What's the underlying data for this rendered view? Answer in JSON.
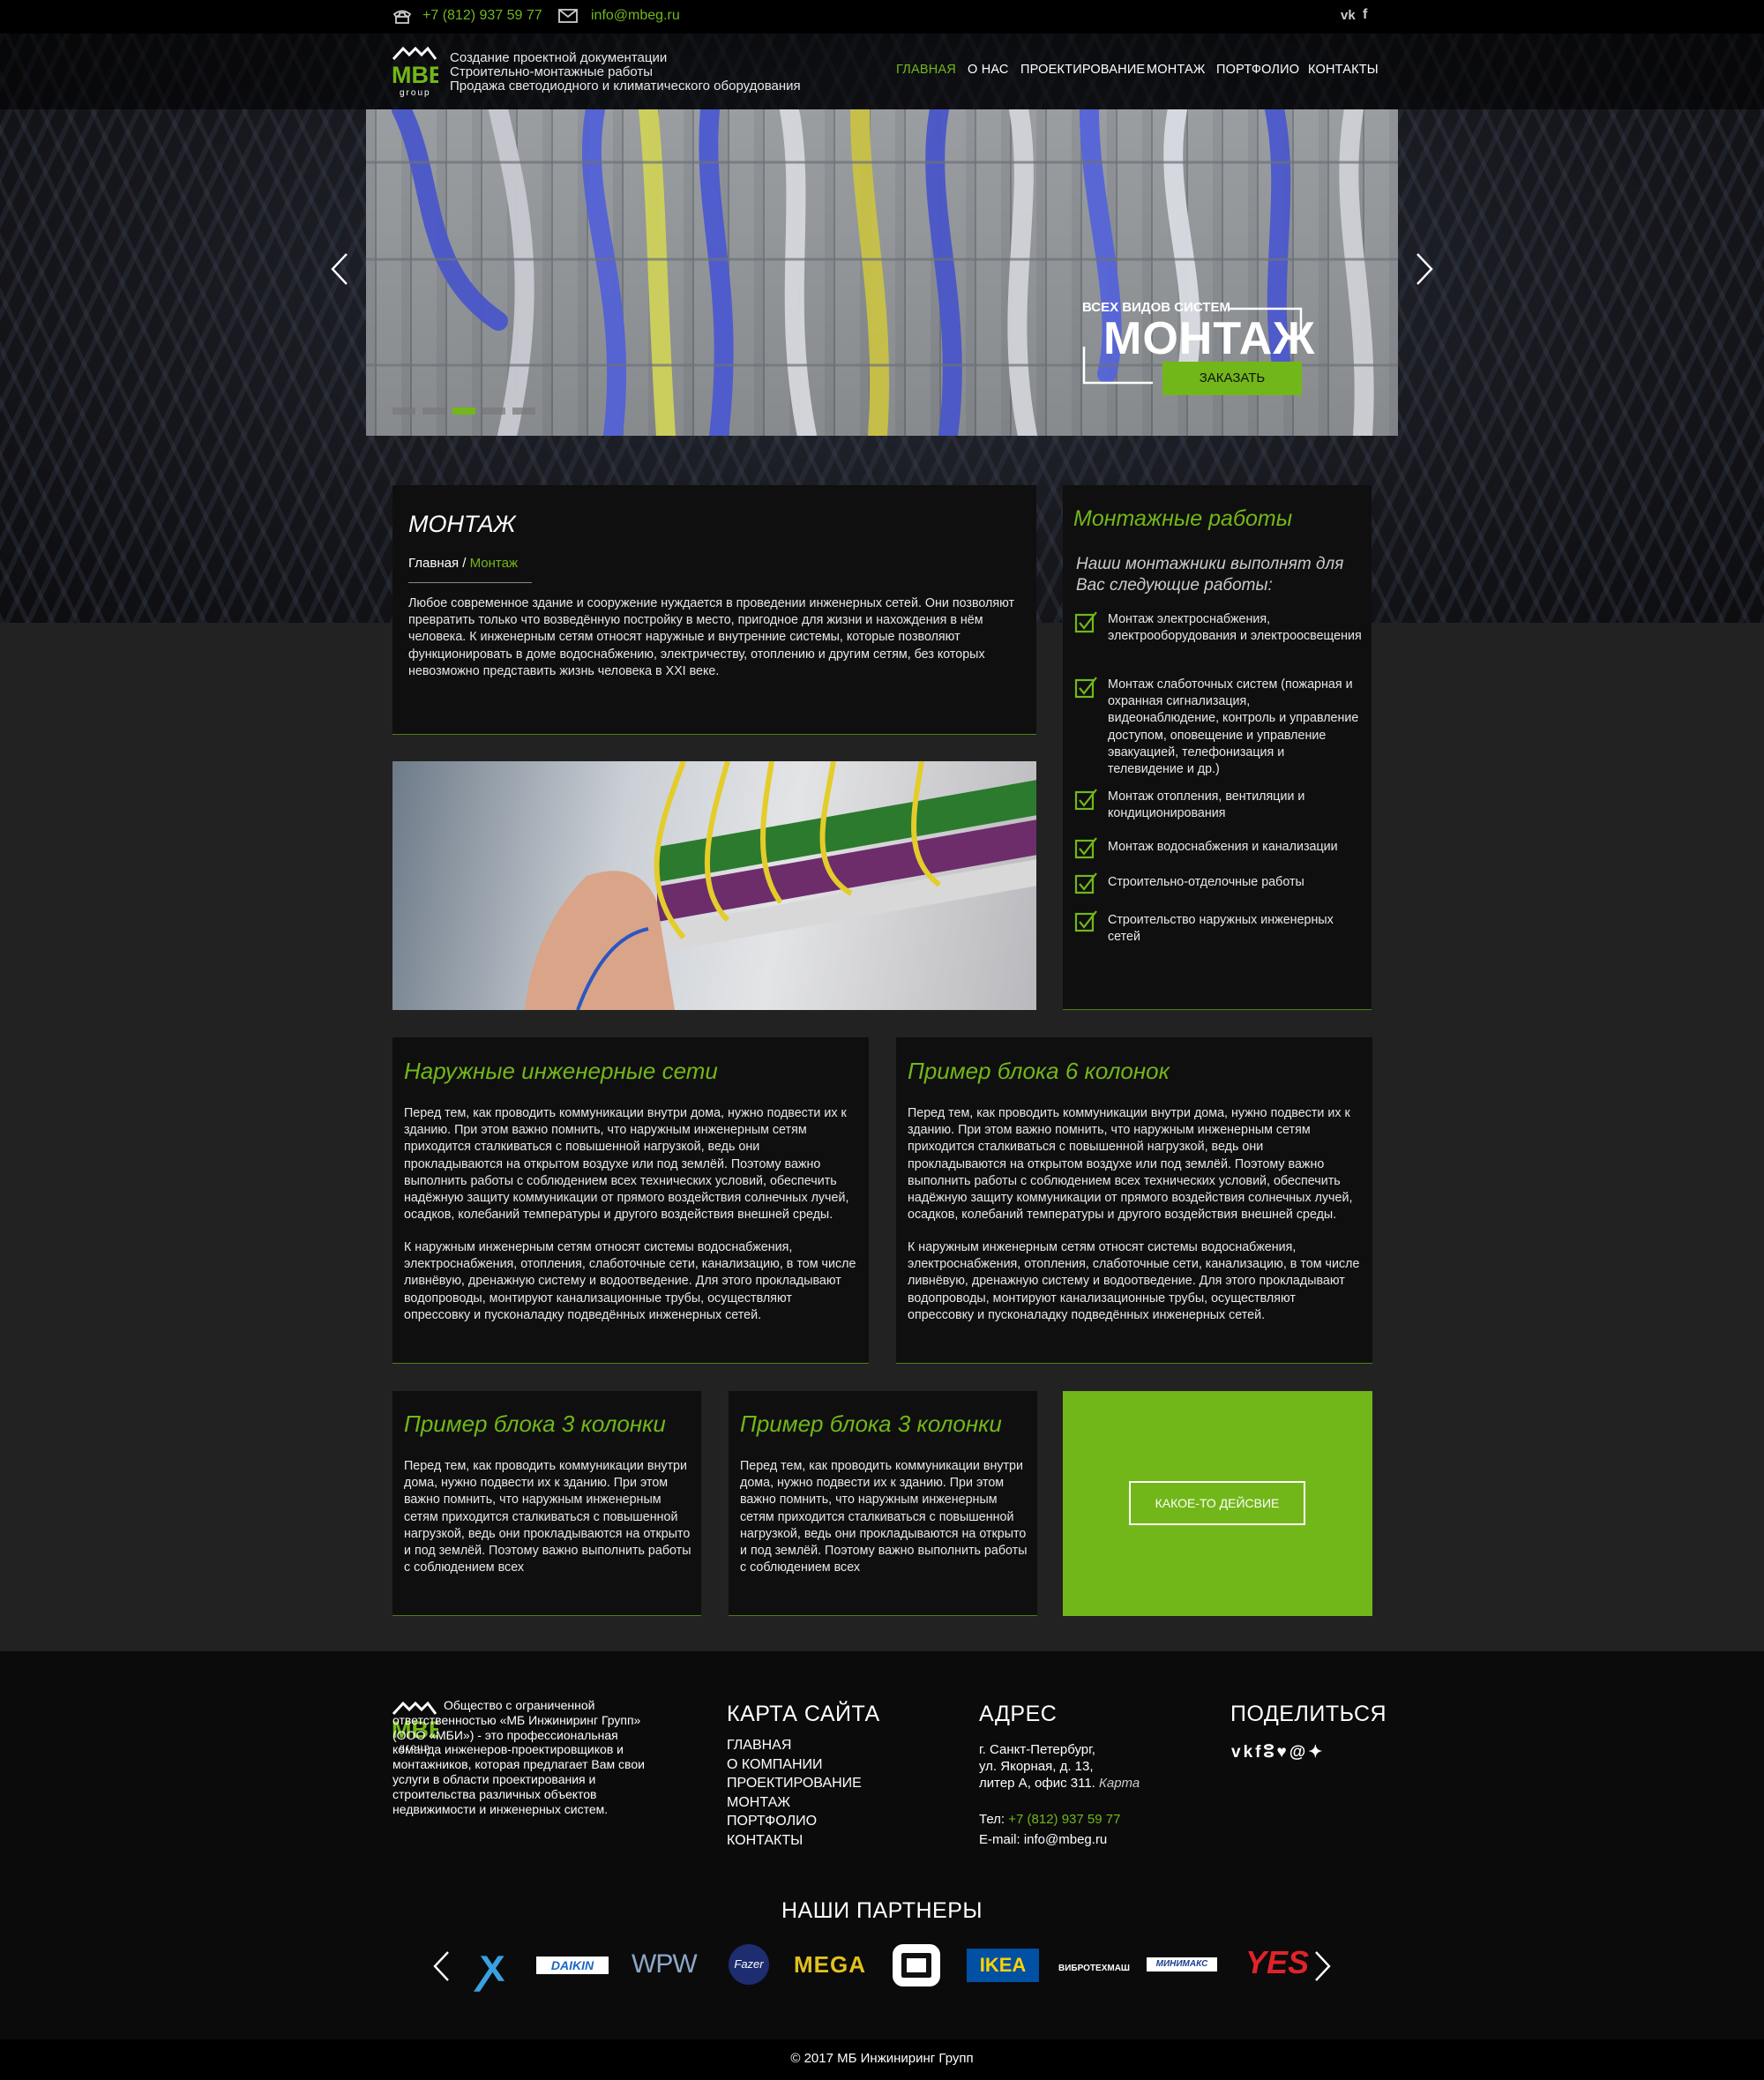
{
  "topbar": {
    "phone": "+7 (812) 937 59 77",
    "email": "info@mbeg.ru",
    "social": [
      "vk-icon",
      "facebook-icon"
    ]
  },
  "logo": {
    "text": "MBE",
    "sub": "group"
  },
  "taglines": [
    "Создание проектной документации",
    "Строительно-монтажные работы",
    "Продажа светодиодного и климатического оборудования"
  ],
  "nav": [
    "ГЛАВНАЯ",
    "О НАС",
    "ПРОЕКТИРОВАНИЕ",
    "МОНТАЖ",
    "ПОРТФОЛИО",
    "КОНТАКТЫ"
  ],
  "slider": {
    "kicker": "ВСЕХ ВИДОВ СИСТЕМ",
    "title": "МОНТАЖ",
    "button": "ЗАКАЗАТЬ",
    "active_dot": 2,
    "dots": 4
  },
  "main": {
    "title": "МОНТАЖ",
    "breadcrumb": {
      "home": "Главная",
      "sep": "/",
      "current": "Монтаж"
    },
    "text": "Любое современное здание и сооружение нуждается в проведении инженерных сетей. Они позволяют превратить только что возведённую постройку в место, пригодное для жизни и нахождения в нём человека.  К инженерным сетям относят наружные и внутренние системы, которые позволяют функционировать в доме водоснабжению, электричеству, отоплению и другим сетям, без которых невозможно представить жизнь человека в XXI веке."
  },
  "sidebar": {
    "title": "Монтажные работы",
    "subtitle": "Наши монтажники выполнят для Вас следующие работы:",
    "items": [
      "Монтаж электроснабжения, электрооборудования и электроосвещения",
      "Монтаж слаботочных систем (пожарная и охранная сигнализация, видеонаблюдение, контроль и управление доступом, оповещение и управление эвакуацией, телефонизация и телевидение и др.)",
      "Монтаж отопления, вентиляции и кондиционирования",
      "Монтаж водоснабжения и канализации",
      "Строительно-отделочные работы",
      "Строительство наружных инженерных сетей"
    ]
  },
  "block6": [
    {
      "title": "Наружные инженерные сети",
      "p1": "Перед тем, как проводить коммуникации внутри дома, нужно подвести их к зданию. При этом важно помнить, что наружным инженерным сетям приходится сталкиваться с повышенной нагрузкой, ведь они прокладываются на открытом воздухе или под землёй. Поэтому важно выполнить работы с соблюдением всех технических условий, обеспечить надёжную защиту коммуникации от прямого воздействия солнечных лучей, осадков, колебаний температуры и другого воздействия внешней среды.",
      "p2": "К наружным инженерным сетям относят системы водоснабжения, электроснабжения, отопления, слаботочные сети, канализацию, в том числе ливнёвую, дренажную систему и водоотведение. Для этого прокладывают водопроводы, монтируют канализационные трубы, осуществляют опрессовку и пусконаладку подведённых инженерных сетей."
    },
    {
      "title": "Пример блока 6 колонок",
      "p1": "Перед тем, как проводить коммуникации внутри дома, нужно подвести их к зданию. При этом важно помнить, что наружным инженерным сетям приходится сталкиваться с повышенной нагрузкой, ведь они прокладываются на открытом воздухе или под землёй. Поэтому важно выполнить работы с соблюдением всех технических условий, обеспечить надёжную защиту коммуникации от прямого воздействия солнечных лучей, осадков, колебаний температуры и другого воздействия внешней среды.",
      "p2": "К наружным инженерным сетям относят системы водоснабжения, электроснабжения, отопления, слаботочные сети, канализацию, в том числе ливнёвую, дренажную систему и водоотведение. Для этого прокладывают водопроводы, монтируют канализационные трубы, осуществляют опрессовку и пусконаладку подведённых инженерных сетей."
    }
  ],
  "block3": [
    {
      "title": "Пример блока 3 колонки",
      "text": "Перед тем, как проводить коммуникации внутри дома, нужно подвести их к зданию. При этом важно помнить, что наружным инженерным сетям приходится сталкиваться с повышенной нагрузкой, ведь они прокладываются на открыто и под землёй. Поэтому важно выполнить работы с соблюдением всех"
    },
    {
      "title": "Пример блока 3 колонки",
      "text": "Перед тем, как проводить коммуникации внутри дома, нужно подвести их к зданию. При этом важно помнить, что наружным инженерным сетям приходится сталкиваться с повышенной нагрузкой, ведь они прокладываются на открыто и под землёй. Поэтому важно выполнить работы с соблюдением всех"
    }
  ],
  "cta": {
    "button": "КАКОЕ-ТО ДЕЙСВИЕ"
  },
  "footer": {
    "about": "Общество с ограниченной ответственностью «МБ Инжиниринг Групп» (ООО «МБИ») - это профессиональная команда инженеров-проектировщиков и монтажников, которая предлагает Вам свои услуги в области проектирования и строительства различных объектов недвижимости и инженерных систем.",
    "sitemap_title": "КАРТА САЙТА",
    "sitemap": [
      "ГЛАВНАЯ",
      "О КОМПАНИИ",
      "ПРОЕКТИРОВАНИЕ",
      "МОНТАЖ",
      "ПОРТФОЛИО",
      "КОНТАКТЫ"
    ],
    "address_title": "АДРЕС",
    "address_lines": [
      "г. Санкт-Петербург,",
      "ул. Якорная, д. 13,",
      "литер А, офис 311."
    ],
    "map_link": "Карта",
    "tel_label": "Тел:",
    "tel": "+7 (812) 937 59 77",
    "email_line": "E-mail: info@mbeg.ru",
    "share_title": "ПОДЕЛИТЬСЯ",
    "share_icons": [
      "vk-icon",
      "facebook-icon",
      "odnoklassniki-icon",
      "twitter-icon",
      "mail-icon",
      "pin-icon"
    ]
  },
  "partners": {
    "title": "НАШИ ПАРТНЕРЫ",
    "logos": [
      "DAIKIN",
      "WPW",
      "Fazer",
      "MEGA",
      "IKEA",
      "ВИБРОТЕХМАШ",
      "МИНИМАКС",
      "YES"
    ]
  },
  "copyright": "© 2017 МБ Инжиниринг Групп",
  "colors": {
    "accent": "#72b719",
    "panel": "#0f0f0f",
    "page": "#222223"
  }
}
